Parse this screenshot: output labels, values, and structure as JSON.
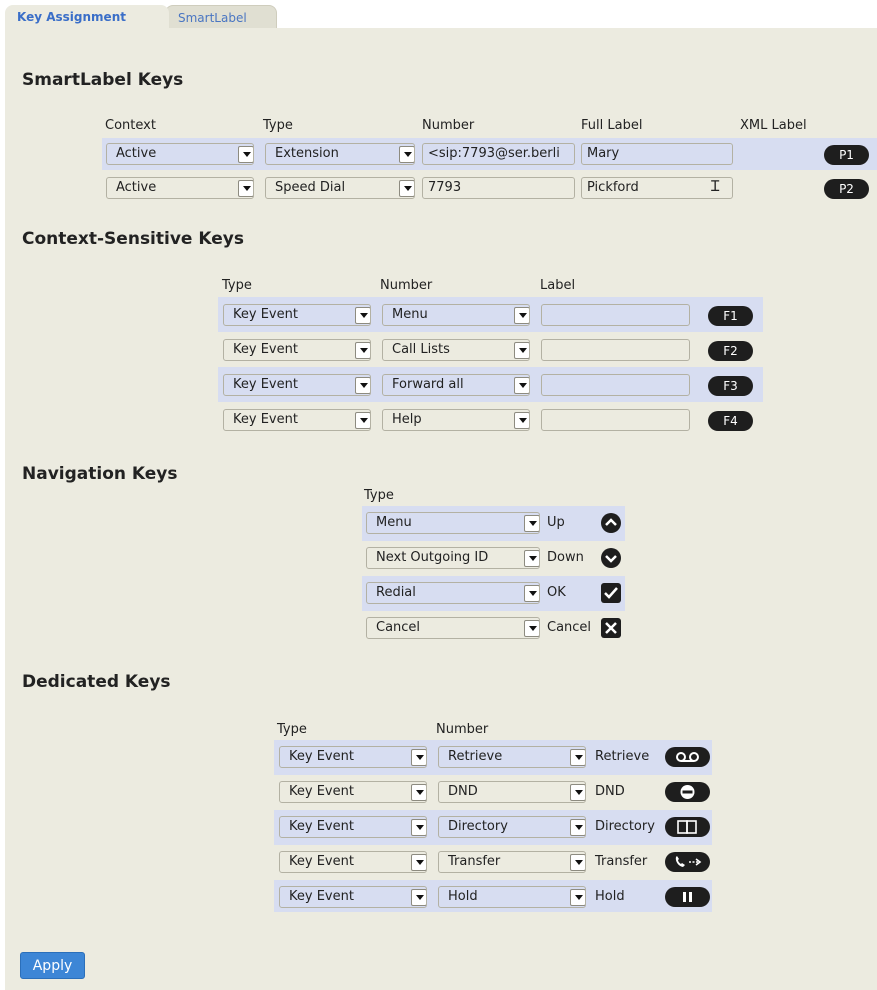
{
  "tabs": {
    "key_assignment": "Key Assignment",
    "smartlabel": "SmartLabel"
  },
  "smartlabel": {
    "title": "SmartLabel Keys",
    "headers": {
      "context": "Context",
      "type": "Type",
      "number": "Number",
      "full_label": "Full Label",
      "xml_label": "XML Label"
    },
    "rows": [
      {
        "context": "Active",
        "type": "Extension",
        "number": "<sip:7793@ser.berli",
        "full_label": "Mary",
        "key": "P1"
      },
      {
        "context": "Active",
        "type": "Speed Dial",
        "number": "7793",
        "full_label": "Pickford",
        "key": "P2"
      }
    ]
  },
  "context_keys": {
    "title": "Context-Sensitive Keys",
    "headers": {
      "type": "Type",
      "number": "Number",
      "label": "Label"
    },
    "rows": [
      {
        "type": "Key Event",
        "number": "Menu",
        "label": "",
        "key": "F1"
      },
      {
        "type": "Key Event",
        "number": "Call Lists",
        "label": "",
        "key": "F2"
      },
      {
        "type": "Key Event",
        "number": "Forward all",
        "label": "",
        "key": "F3"
      },
      {
        "type": "Key Event",
        "number": "Help",
        "label": "",
        "key": "F4"
      }
    ]
  },
  "navigation": {
    "title": "Navigation Keys",
    "headers": {
      "type": "Type"
    },
    "rows": [
      {
        "type": "Menu",
        "key": "Up",
        "icon": "chevron-up-icon"
      },
      {
        "type": "Next Outgoing ID",
        "key": "Down",
        "icon": "chevron-down-icon"
      },
      {
        "type": "Redial",
        "key": "OK",
        "icon": "checkmark-icon"
      },
      {
        "type": "Cancel",
        "key": "Cancel",
        "icon": "close-icon"
      }
    ]
  },
  "dedicated": {
    "title": "Dedicated Keys",
    "headers": {
      "type": "Type",
      "number": "Number"
    },
    "rows": [
      {
        "type": "Key Event",
        "number": "Retrieve",
        "key": "Retrieve",
        "icon": "voicemail-icon"
      },
      {
        "type": "Key Event",
        "number": "DND",
        "key": "DND",
        "icon": "do-not-disturb-icon"
      },
      {
        "type": "Key Event",
        "number": "Directory",
        "key": "Directory",
        "icon": "directory-book-icon"
      },
      {
        "type": "Key Event",
        "number": "Transfer",
        "key": "Transfer",
        "icon": "transfer-icon"
      },
      {
        "type": "Key Event",
        "number": "Hold",
        "key": "Hold",
        "icon": "hold-icon"
      }
    ]
  },
  "apply_label": "Apply",
  "colors": {
    "panel": "#ecebe0",
    "highlight_row": "#d7ddf1",
    "link_blue": "#3a6ec8",
    "apply_button": "#3d86d6",
    "key_pill": "#1e1e1e"
  }
}
